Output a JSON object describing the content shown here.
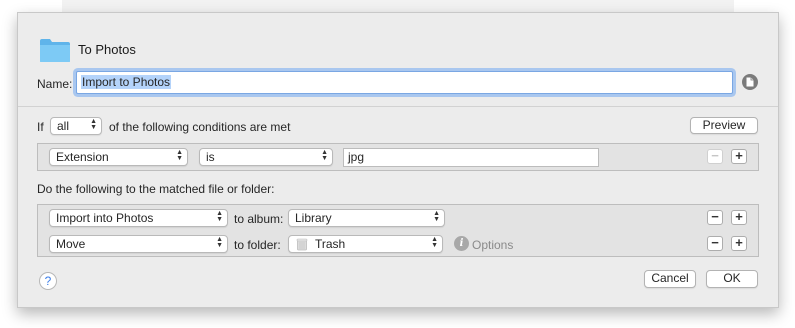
{
  "title": "To Photos",
  "name_label": "Name:",
  "name_value": "Import to Photos",
  "conditions": {
    "if_label": "If",
    "match_value": "all",
    "suffix": "of the following conditions are met",
    "preview_label": "Preview",
    "rule": {
      "attribute": "Extension",
      "operator": "is",
      "value": "jpg"
    }
  },
  "actions_heading": "Do the following to the matched file or folder:",
  "actions": [
    {
      "action": "Import into Photos",
      "target_label": "to album:",
      "target": "Library"
    },
    {
      "action": "Move",
      "target_label": "to folder:",
      "target": "Trash",
      "options_label": "Options"
    }
  ],
  "footer": {
    "help": "?",
    "cancel": "Cancel",
    "ok": "OK"
  },
  "icons": {
    "folder": "folder-icon",
    "document": "document-icon",
    "trash": "trash-icon",
    "info": "info-icon",
    "popup_arrows": "up-down-arrows-icon"
  },
  "colors": {
    "accent": "#3b7de8",
    "folder": "#6ec0f2",
    "selection": "#b4d3fa"
  }
}
